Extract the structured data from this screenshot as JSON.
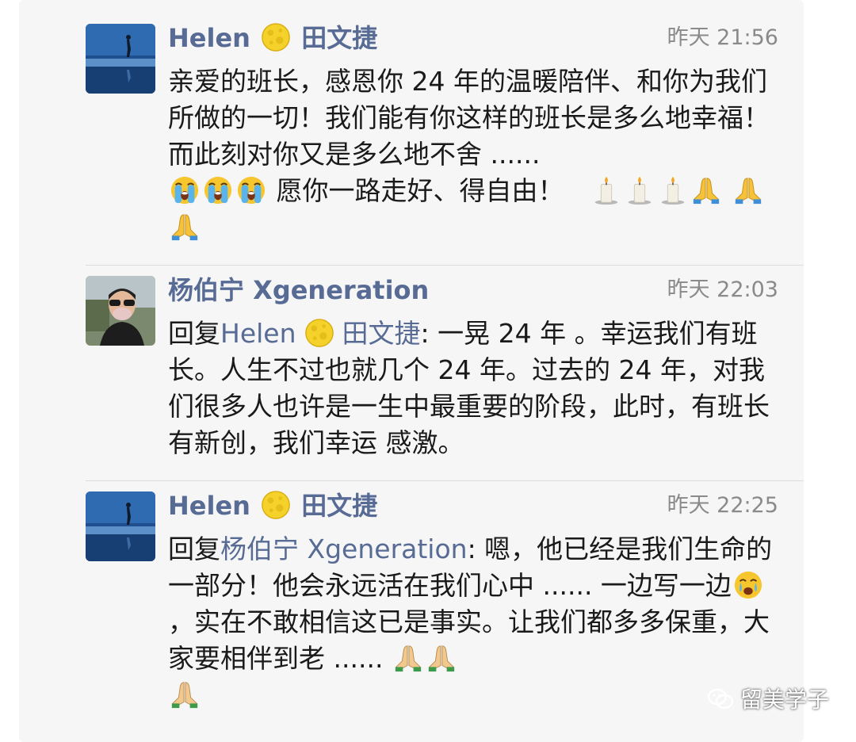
{
  "comments": [
    {
      "author": "Helen",
      "author_suffix": "田文捷",
      "time": "昨天 21:56",
      "text_1": "亲爱的班长，感恩你 24 年的温暖陪伴、和你为我们所做的一切！我们能有你这样的班长是多么地幸福！而此刻对你又是多么地不舍 ......",
      "text_2": " 愿你一路走好、得自由！"
    },
    {
      "author": "杨伯宁 Xgeneration",
      "time": "昨天 22:03",
      "reply_prefix": "回复",
      "reply_to": "Helen",
      "reply_to_suffix": "田文捷",
      "text": ": 一晃 24 年 。幸运我们有班长。人生不过也就几个 24 年。过去的 24 年，对我们很多人也许是一生中最重要的阶段，此时，有班长 有新创，我们幸运 感激。"
    },
    {
      "author": "Helen",
      "author_suffix": "田文捷",
      "time": "昨天 22:25",
      "reply_prefix": "回复",
      "reply_to": "杨伯宁 Xgeneration",
      "text_1": ": 嗯，他已经是我们生命的一部分！他会永远活在我们心中 ...... 一边写一边",
      "text_2": "，实在不敢相信这已是事实。让我们都多多保重，大家要相伴到老 ...... "
    }
  ],
  "watermark": "留美学子",
  "icons": [
    "moon-emoji-icon",
    "crying-emoji-icon",
    "candle-emoji-icon",
    "praying-hands-emoji-icon",
    "wechat-icon"
  ],
  "colors": {
    "name_link": "#576b95",
    "text": "#1a1a1a",
    "time": "#8a8a8a",
    "panel": "#f6f6f6"
  }
}
